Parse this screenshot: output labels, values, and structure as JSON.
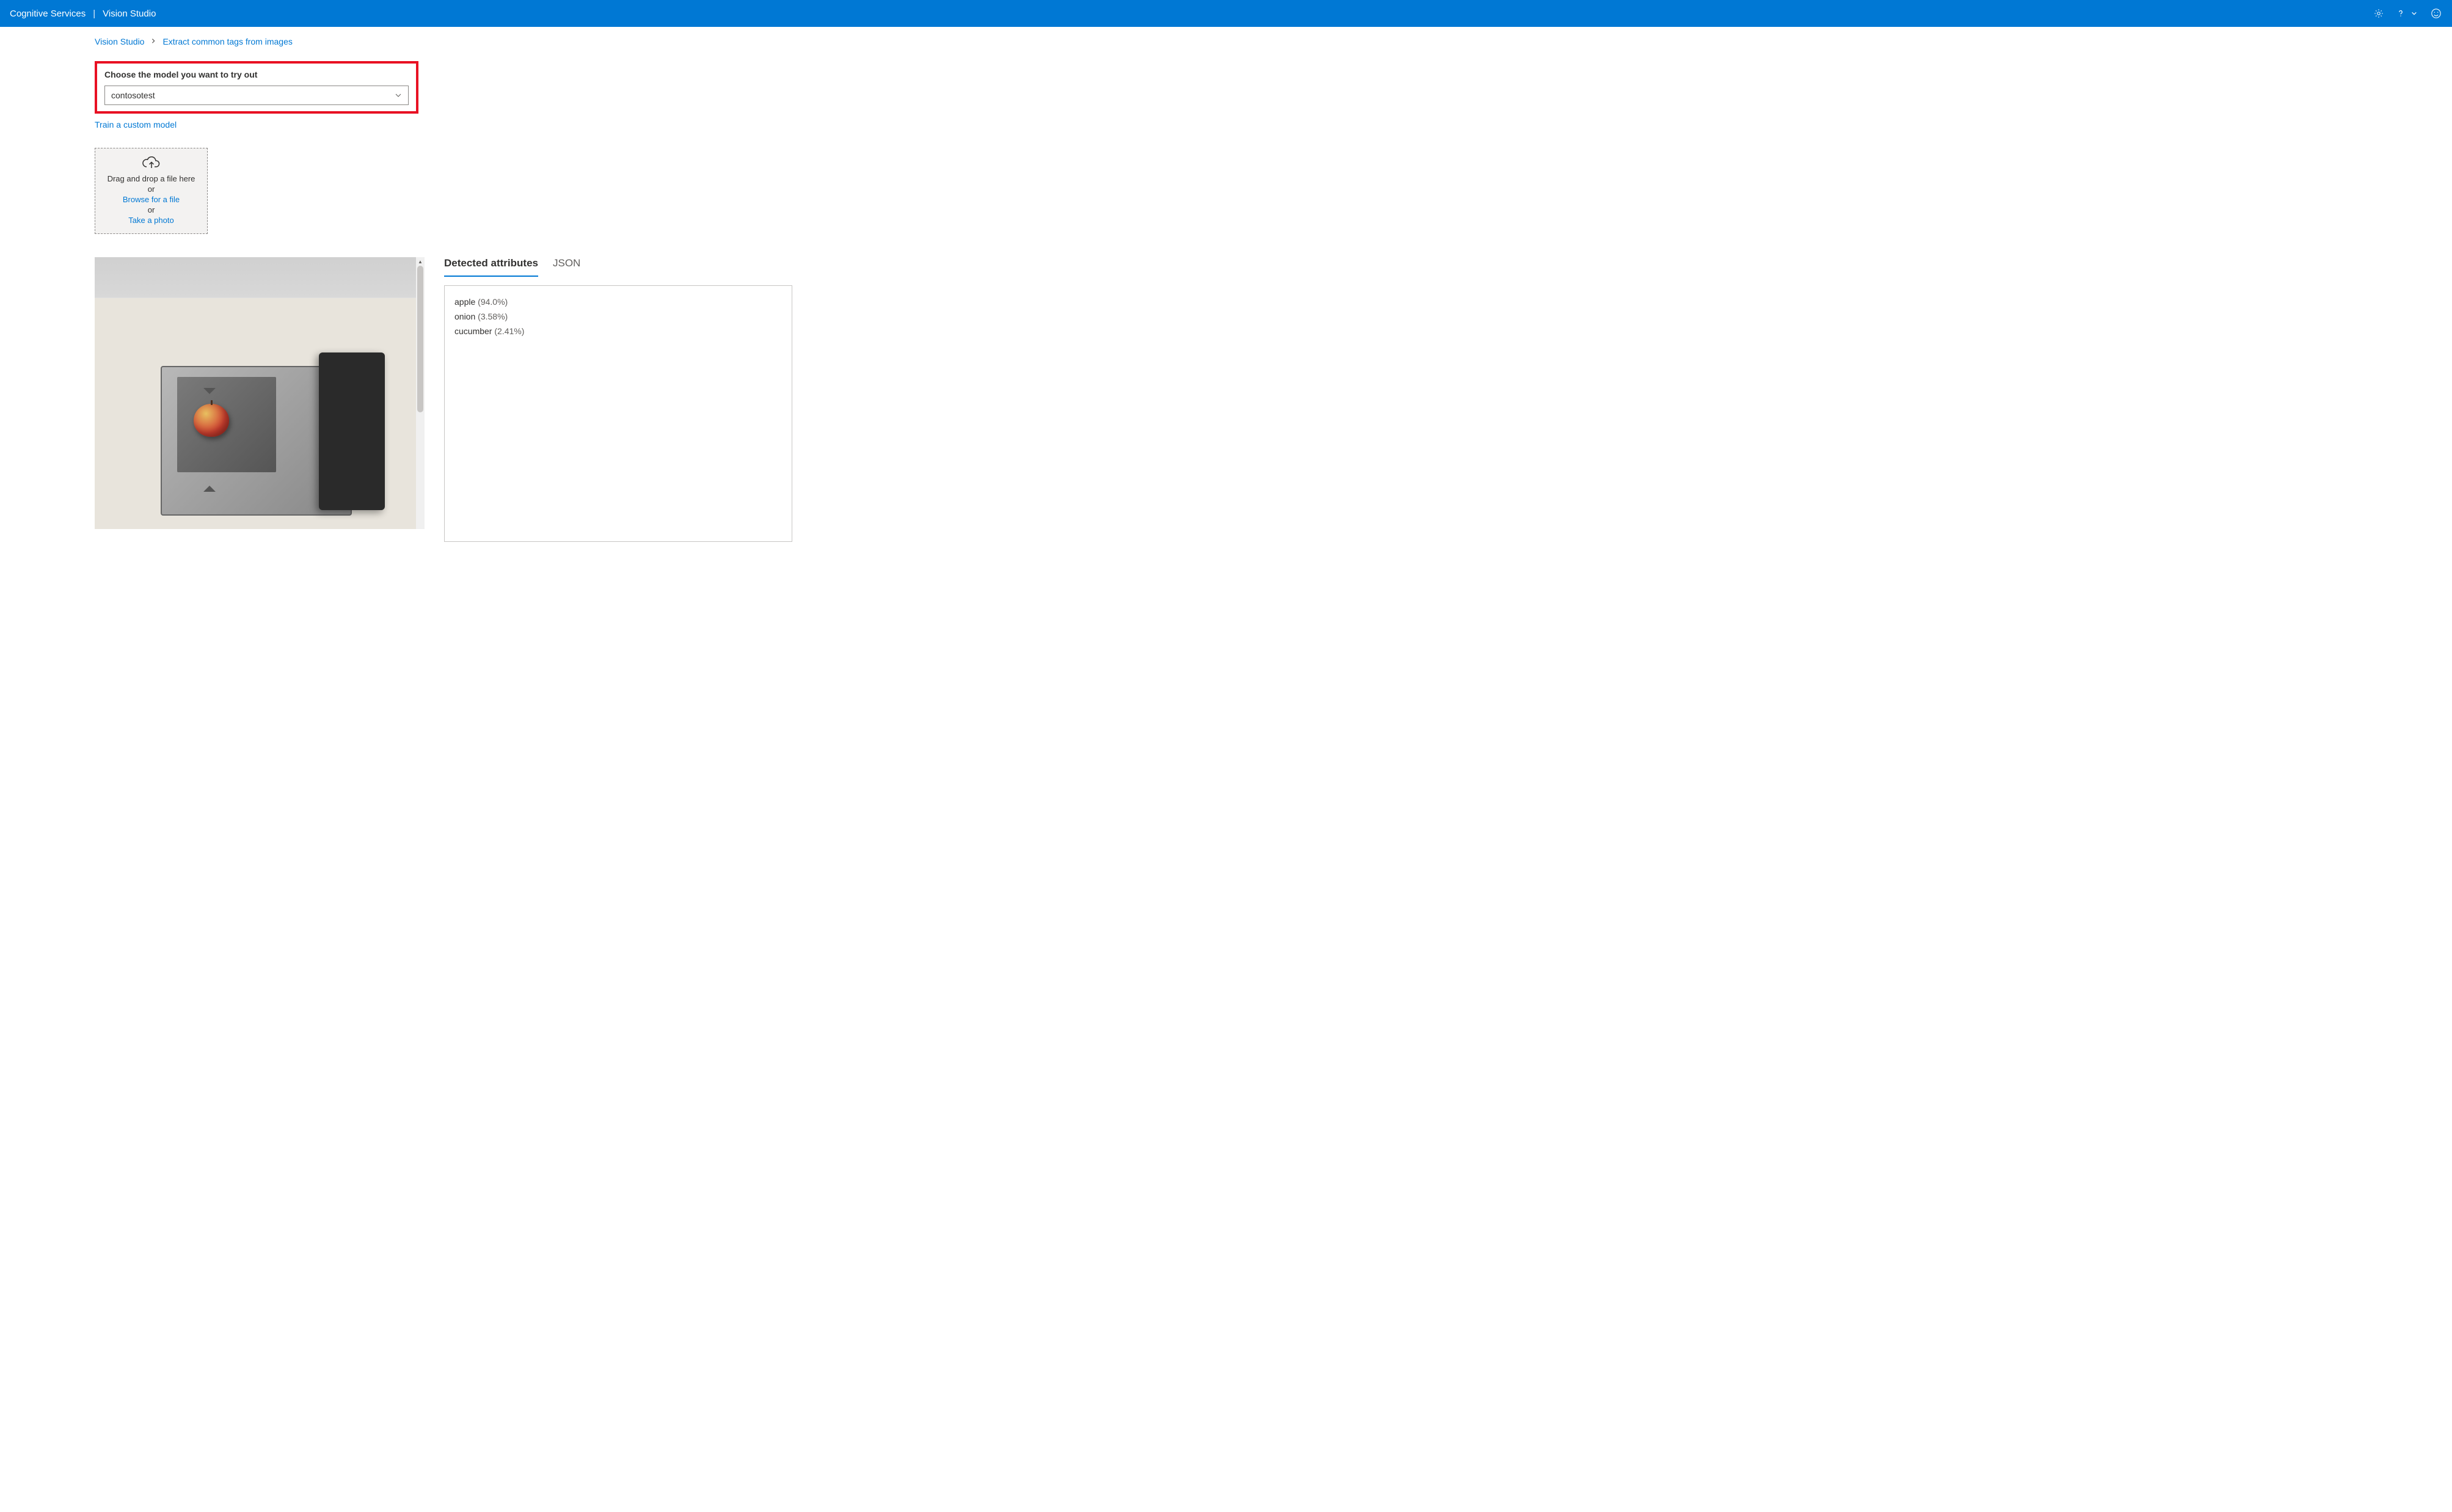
{
  "header": {
    "service": "Cognitive Services",
    "studio": "Vision Studio"
  },
  "breadcrumb": {
    "root": "Vision Studio",
    "current": "Extract common tags from images"
  },
  "model_selector": {
    "label": "Choose the model you want to try out",
    "selected": "contosotest",
    "train_link": "Train a custom model"
  },
  "dropzone": {
    "line1": "Drag and drop a file here",
    "or1": "or",
    "browse": "Browse for a file",
    "or2": "or",
    "photo": "Take a photo"
  },
  "tabs": {
    "detected": "Detected attributes",
    "json": "JSON"
  },
  "results": [
    {
      "label": "apple",
      "confidence": "(94.0%)"
    },
    {
      "label": "onion",
      "confidence": "(3.58%)"
    },
    {
      "label": "cucumber",
      "confidence": "(2.41%)"
    }
  ]
}
